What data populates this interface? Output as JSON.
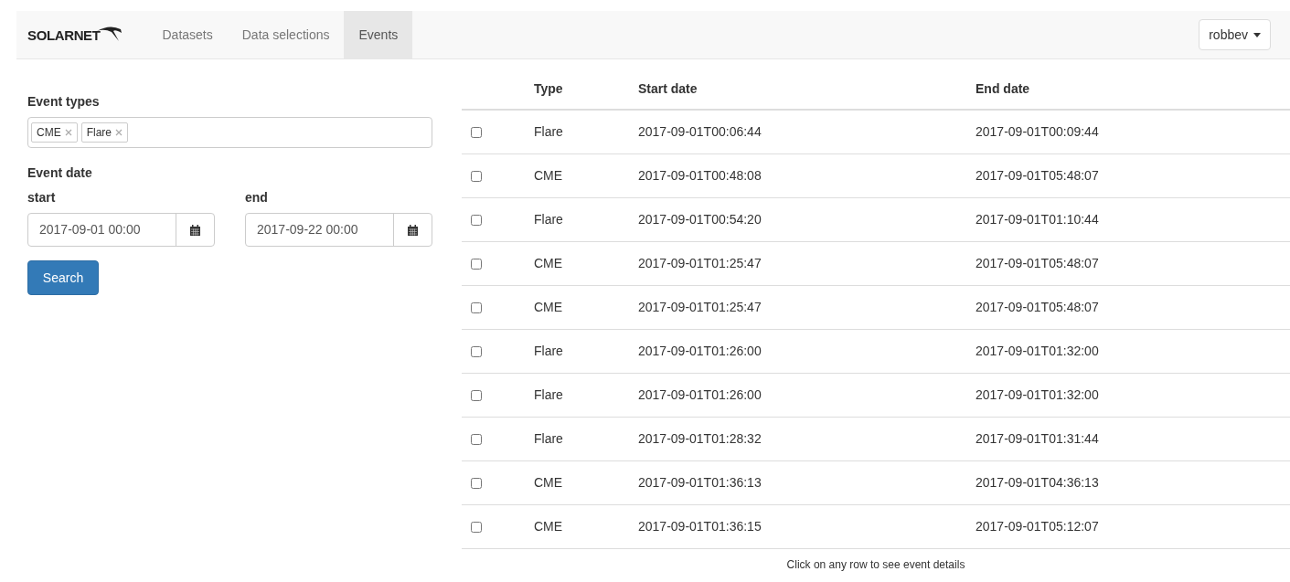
{
  "navbar": {
    "brand": "SOLARNET",
    "tabs": [
      {
        "label": "Datasets",
        "selected": false
      },
      {
        "label": "Data selections",
        "selected": false
      },
      {
        "label": "Events",
        "selected": true
      }
    ],
    "user": "robbev"
  },
  "filters": {
    "event_types_label": "Event types",
    "event_types": [
      "CME",
      "Flare"
    ],
    "event_date_label": "Event date",
    "start_label": "start",
    "start_value": "2017-09-01 00:00",
    "end_label": "end",
    "end_value": "2017-09-22 00:00",
    "search_button": "Search"
  },
  "table": {
    "columns": [
      "Type",
      "Start date",
      "End date"
    ],
    "rows": [
      {
        "checked": false,
        "type": "Flare",
        "start": "2017-09-01T00:06:44",
        "end": "2017-09-01T00:09:44"
      },
      {
        "checked": false,
        "type": "CME",
        "start": "2017-09-01T00:48:08",
        "end": "2017-09-01T05:48:07"
      },
      {
        "checked": false,
        "type": "Flare",
        "start": "2017-09-01T00:54:20",
        "end": "2017-09-01T01:10:44"
      },
      {
        "checked": false,
        "type": "CME",
        "start": "2017-09-01T01:25:47",
        "end": "2017-09-01T05:48:07"
      },
      {
        "checked": false,
        "type": "CME",
        "start": "2017-09-01T01:25:47",
        "end": "2017-09-01T05:48:07"
      },
      {
        "checked": false,
        "type": "Flare",
        "start": "2017-09-01T01:26:00",
        "end": "2017-09-01T01:32:00"
      },
      {
        "checked": false,
        "type": "Flare",
        "start": "2017-09-01T01:26:00",
        "end": "2017-09-01T01:32:00"
      },
      {
        "checked": false,
        "type": "Flare",
        "start": "2017-09-01T01:28:32",
        "end": "2017-09-01T01:31:44"
      },
      {
        "checked": false,
        "type": "CME",
        "start": "2017-09-01T01:36:13",
        "end": "2017-09-01T04:36:13"
      },
      {
        "checked": false,
        "type": "CME",
        "start": "2017-09-01T01:36:15",
        "end": "2017-09-01T05:12:07"
      }
    ],
    "footer": "Click on any row to see event details"
  }
}
